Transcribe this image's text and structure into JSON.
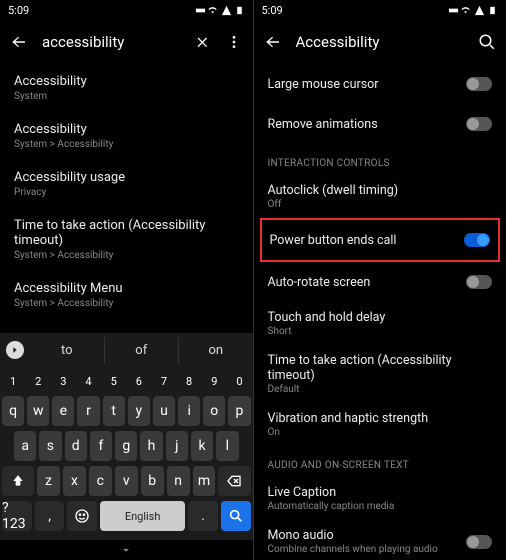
{
  "left": {
    "status_time": "5:09",
    "search_query": "accessibility",
    "results": [
      {
        "title": "Accessibility",
        "subtitle": "System"
      },
      {
        "title": "Accessibility",
        "subtitle": "System > Accessibility"
      },
      {
        "title": "Accessibility usage",
        "subtitle": "Privacy"
      },
      {
        "title": "Time to take action (Accessibility timeout)",
        "subtitle": "System > Accessibility"
      },
      {
        "title": "Accessibility Menu",
        "subtitle": "System > Accessibility"
      }
    ],
    "suggestions": [
      "to",
      "of",
      "on"
    ],
    "keyboard_rows": {
      "numbers": [
        "1",
        "2",
        "3",
        "4",
        "5",
        "6",
        "7",
        "8",
        "9",
        "0"
      ],
      "row1": [
        "q",
        "w",
        "e",
        "r",
        "t",
        "y",
        "u",
        "i",
        "o",
        "p"
      ],
      "row2": [
        "a",
        "s",
        "d",
        "f",
        "g",
        "h",
        "j",
        "k",
        "l"
      ],
      "row3": [
        "z",
        "x",
        "c",
        "v",
        "b",
        "n",
        "m"
      ]
    },
    "symbol_key": "?123",
    "comma_key": ",",
    "period_key": ".",
    "space_label": "English"
  },
  "right": {
    "status_time": "5:09",
    "header_title": "Accessibility",
    "items_top": [
      {
        "title": "Large mouse cursor",
        "toggle": "off"
      },
      {
        "title": "Remove animations",
        "toggle": "off"
      }
    ],
    "section1": "INTERACTION CONTROLS",
    "interaction_items": [
      {
        "title": "Autoclick (dwell timing)",
        "subtitle": "Off"
      },
      {
        "title": "Power button ends call",
        "toggle": "on",
        "highlighted": true
      },
      {
        "title": "Auto-rotate screen",
        "toggle": "off"
      },
      {
        "title": "Touch and hold delay",
        "subtitle": "Short"
      },
      {
        "title": "Time to take action (Accessibility timeout)",
        "subtitle": "Default"
      },
      {
        "title": "Vibration and haptic strength",
        "subtitle": "On"
      }
    ],
    "section2": "AUDIO AND ON-SCREEN TEXT",
    "audio_items": [
      {
        "title": "Live Caption",
        "subtitle": "Automatically caption media"
      },
      {
        "title": "Mono audio",
        "subtitle": "Combine channels when playing audio",
        "toggle": "off"
      }
    ]
  }
}
